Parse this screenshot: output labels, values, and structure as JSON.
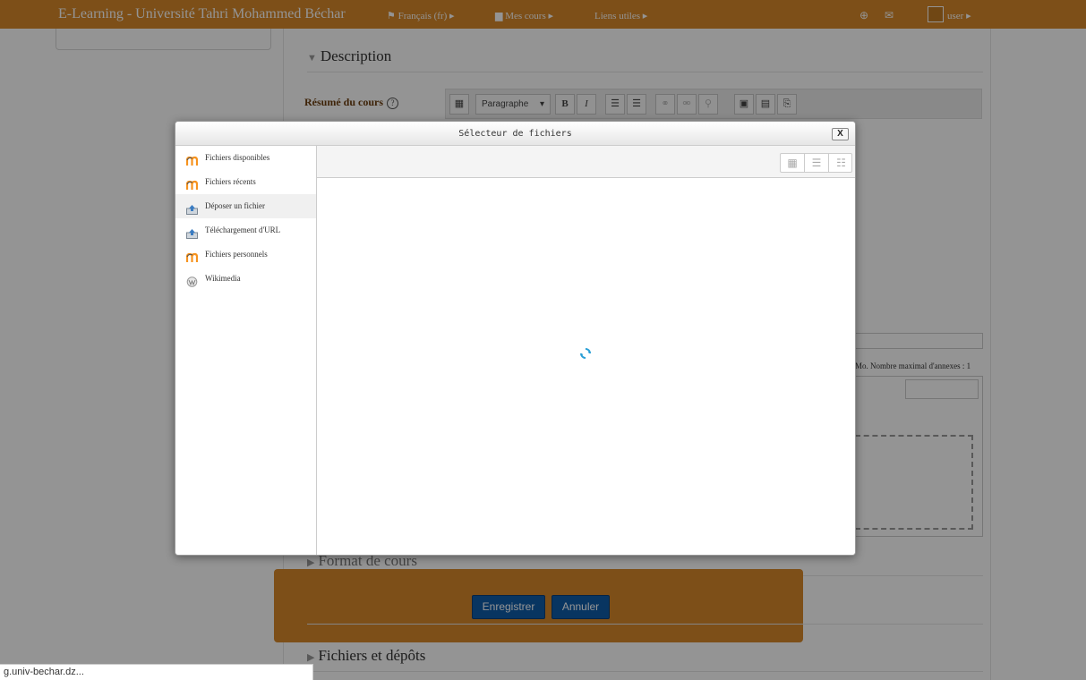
{
  "navbar": {
    "brand": "E-Learning - Université Tahri Mohammed Béchar",
    "language": "Français (fr) ▸",
    "my_courses": "Mes cours ▸",
    "useful_links": "Liens utiles ▸",
    "user": "user ▸"
  },
  "form": {
    "section_description": "Description",
    "summary_label": "Résumé du cours",
    "paragraph_select": "Paragraphe",
    "max_files_note": "Mo. Nombre maximal d'annexes : 1",
    "section_format": "Format de cours",
    "section_files": "Fichiers et dépôts"
  },
  "buttons": {
    "save": "Enregistrer",
    "cancel": "Annuler"
  },
  "dialog": {
    "title": "Sélecteur de fichiers",
    "close": "X",
    "repositories": [
      {
        "label": "Fichiers disponibles",
        "icon": "moodle-icon"
      },
      {
        "label": "Fichiers récents",
        "icon": "moodle-icon"
      },
      {
        "label": "Déposer un fichier",
        "icon": "upload-icon",
        "active": true
      },
      {
        "label": "Téléchargement d'URL",
        "icon": "url-download-icon"
      },
      {
        "label": "Fichiers personnels",
        "icon": "moodle-icon"
      },
      {
        "label": "Wikimedia",
        "icon": "wikimedia-icon"
      }
    ],
    "view_modes": [
      "icons-view",
      "list-view",
      "tree-view"
    ]
  },
  "statusbar": {
    "url": "g.univ-bechar.dz..."
  },
  "colors": {
    "brand": "#d7892a",
    "primary_button": "#0f5ca8",
    "spinner": "#2a9fd6"
  }
}
